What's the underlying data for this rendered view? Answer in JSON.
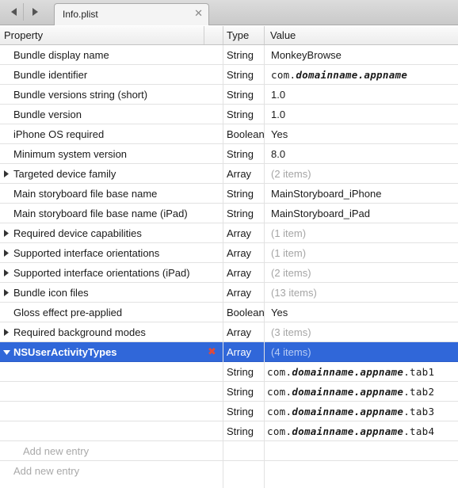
{
  "tab": {
    "title": "Info.plist"
  },
  "columns": {
    "property": "Property",
    "type": "Type",
    "value": "Value"
  },
  "rows": [
    {
      "property": "Bundle display name",
      "type": "String",
      "value": "MonkeyBrowse"
    },
    {
      "property": "Bundle identifier",
      "type": "String",
      "value_prefix": "com.",
      "value_italic": "domainname.appname",
      "value_suffix": ""
    },
    {
      "property": "Bundle versions string (short)",
      "type": "String",
      "value": "1.0"
    },
    {
      "property": "Bundle version",
      "type": "String",
      "value": "1.0"
    },
    {
      "property": "iPhone OS required",
      "type": "Boolean",
      "value": "Yes"
    },
    {
      "property": "Minimum system version",
      "type": "String",
      "value": "8.0"
    },
    {
      "property": "Targeted device family",
      "type": "Array",
      "value": "(2 items)"
    },
    {
      "property": "Main storyboard file base name",
      "type": "String",
      "value": "MainStoryboard_iPhone"
    },
    {
      "property": "Main storyboard file base name (iPad)",
      "type": "String",
      "value": "MainStoryboard_iPad"
    },
    {
      "property": "Required device capabilities",
      "type": "Array",
      "value": "(1 item)"
    },
    {
      "property": "Supported interface orientations",
      "type": "Array",
      "value": "(1 item)"
    },
    {
      "property": "Supported interface orientations (iPad)",
      "type": "Array",
      "value": "(2 items)"
    },
    {
      "property": "Bundle icon files",
      "type": "Array",
      "value": "(13 items)"
    },
    {
      "property": "Gloss effect pre-applied",
      "type": "Boolean",
      "value": "Yes"
    },
    {
      "property": "Required background modes",
      "type": "Array",
      "value": "(3 items)"
    },
    {
      "property": "NSUserActivityTypes",
      "type": "Array",
      "value": "(4 items)"
    },
    {
      "type": "String",
      "value_prefix": "com.",
      "value_italic": "domainname.appname",
      "value_suffix": ".tab1"
    },
    {
      "type": "String",
      "value_prefix": "com.",
      "value_italic": "domainname.appname",
      "value_suffix": ".tab2"
    },
    {
      "type": "String",
      "value_prefix": "com.",
      "value_italic": "domainname.appname",
      "value_suffix": ".tab3"
    },
    {
      "type": "String",
      "value_prefix": "com.",
      "value_italic": "domainname.appname",
      "value_suffix": ".tab4"
    }
  ],
  "add_entry_nested": "Add new entry",
  "add_entry_root": "Add new entry",
  "icons": {
    "back": "chevron-left-icon",
    "forward": "chevron-right-icon",
    "close": "close-icon",
    "delete": "delete-x-icon",
    "disclosure": "disclosure-triangle-icon"
  },
  "colors": {
    "selection": "#3067d9",
    "delete": "#e04a3a"
  }
}
